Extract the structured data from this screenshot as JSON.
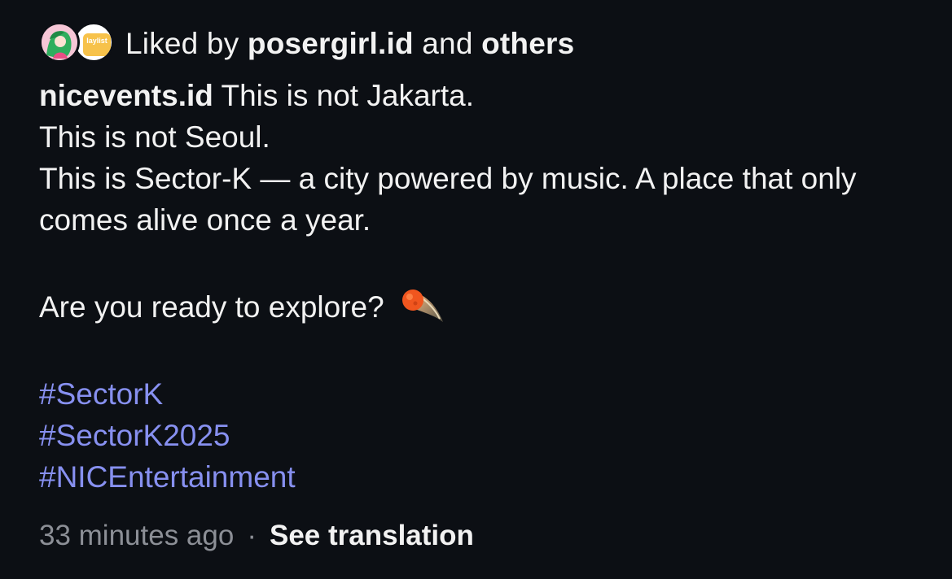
{
  "likes": {
    "prefix": "Liked by ",
    "user": "posergirl.id",
    "conjunction": " and ",
    "others": "others",
    "avatar_2_text": "laylist"
  },
  "caption": {
    "username": "nicevents.id",
    "line1": " This is not Jakarta.",
    "line2": "This is not Seoul.",
    "line3": "This is Sector-K — a city powered by music. A place that only comes alive once a year.",
    "question": "Are you ready to explore? ",
    "emoji": "comet-emoji",
    "hashtags": [
      "#SectorK",
      "#SectorK2025",
      "#NICEntertainment"
    ]
  },
  "meta": {
    "time": "33 minutes ago",
    "separator": "·",
    "translate": "See translation"
  },
  "colors": {
    "background": "#0c0f14",
    "text": "#f2f2f2",
    "muted": "#8c8f96",
    "hashtag": "#8790f0"
  }
}
